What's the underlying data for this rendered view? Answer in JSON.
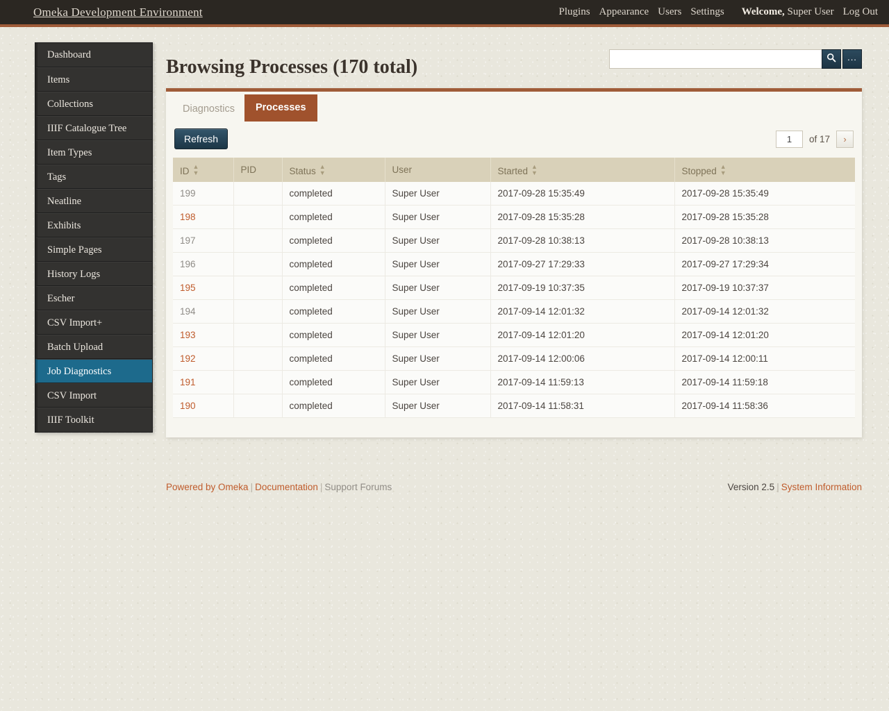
{
  "header": {
    "site_title": "Omeka Development Environment",
    "nav": [
      {
        "label": "Plugins"
      },
      {
        "label": "Appearance"
      },
      {
        "label": "Users"
      },
      {
        "label": "Settings"
      }
    ],
    "welcome_label": "Welcome,",
    "user_name": "Super User",
    "logout_label": "Log Out",
    "accent_color": "#a05c39",
    "bar_color": "#2b2722"
  },
  "sidebar": {
    "items": [
      {
        "label": "Dashboard",
        "active": false
      },
      {
        "label": "Items",
        "active": false
      },
      {
        "label": "Collections",
        "active": false
      },
      {
        "label": "IIIF Catalogue Tree",
        "active": false
      },
      {
        "label": "Item Types",
        "active": false
      },
      {
        "label": "Tags",
        "active": false
      },
      {
        "label": "Neatline",
        "active": false
      },
      {
        "label": "Exhibits",
        "active": false
      },
      {
        "label": "Simple Pages",
        "active": false
      },
      {
        "label": "History Logs",
        "active": false
      },
      {
        "label": "Escher",
        "active": false
      },
      {
        "label": "CSV Import+",
        "active": false
      },
      {
        "label": "Batch Upload",
        "active": false
      },
      {
        "label": "Job Diagnostics",
        "active": true
      },
      {
        "label": "CSV Import",
        "active": false
      },
      {
        "label": "IIIF Toolkit",
        "active": false
      }
    ],
    "active_color": "#1d6a8c"
  },
  "main": {
    "page_title": "Browsing Processes (170 total)",
    "search": {
      "value": "",
      "placeholder": "",
      "search_icon": "search-icon",
      "options_label": "..."
    },
    "tabs": [
      {
        "label": "Diagnostics",
        "active": false
      },
      {
        "label": "Processes",
        "active": true
      }
    ],
    "tab_active_color": "#a0522d",
    "toolbar": {
      "refresh_label": "Refresh"
    },
    "pagination": {
      "current_page": "1",
      "of_label": "of 17",
      "next_icon": "chevron-right-icon"
    },
    "table": {
      "columns": [
        {
          "label": "ID",
          "sortable": true
        },
        {
          "label": "PID",
          "sortable": false
        },
        {
          "label": "Status",
          "sortable": true
        },
        {
          "label": "User",
          "sortable": false
        },
        {
          "label": "Started",
          "sortable": true
        },
        {
          "label": "Stopped",
          "sortable": true
        }
      ],
      "rows": [
        {
          "id": "199",
          "id_style": "gray",
          "pid": "",
          "status": "completed",
          "user": "Super User",
          "started": "2017-09-28 15:35:49",
          "stopped": "2017-09-28 15:35:49"
        },
        {
          "id": "198",
          "id_style": "orange",
          "pid": "",
          "status": "completed",
          "user": "Super User",
          "started": "2017-09-28 15:35:28",
          "stopped": "2017-09-28 15:35:28"
        },
        {
          "id": "197",
          "id_style": "gray",
          "pid": "",
          "status": "completed",
          "user": "Super User",
          "started": "2017-09-28 10:38:13",
          "stopped": "2017-09-28 10:38:13"
        },
        {
          "id": "196",
          "id_style": "gray",
          "pid": "",
          "status": "completed",
          "user": "Super User",
          "started": "2017-09-27 17:29:33",
          "stopped": "2017-09-27 17:29:34"
        },
        {
          "id": "195",
          "id_style": "orange",
          "pid": "",
          "status": "completed",
          "user": "Super User",
          "started": "2017-09-19 10:37:35",
          "stopped": "2017-09-19 10:37:37"
        },
        {
          "id": "194",
          "id_style": "gray",
          "pid": "",
          "status": "completed",
          "user": "Super User",
          "started": "2017-09-14 12:01:32",
          "stopped": "2017-09-14 12:01:32"
        },
        {
          "id": "193",
          "id_style": "orange",
          "pid": "",
          "status": "completed",
          "user": "Super User",
          "started": "2017-09-14 12:01:20",
          "stopped": "2017-09-14 12:01:20"
        },
        {
          "id": "192",
          "id_style": "orange",
          "pid": "",
          "status": "completed",
          "user": "Super User",
          "started": "2017-09-14 12:00:06",
          "stopped": "2017-09-14 12:00:11"
        },
        {
          "id": "191",
          "id_style": "orange",
          "pid": "",
          "status": "completed",
          "user": "Super User",
          "started": "2017-09-14 11:59:13",
          "stopped": "2017-09-14 11:59:18"
        },
        {
          "id": "190",
          "id_style": "orange",
          "pid": "",
          "status": "completed",
          "user": "Super User",
          "started": "2017-09-14 11:58:31",
          "stopped": "2017-09-14 11:58:36"
        }
      ]
    }
  },
  "footer": {
    "powered_by": "Powered by Omeka",
    "documentation": "Documentation",
    "support_forums": "Support Forums",
    "version": "Version 2.5",
    "system_information": "System Information",
    "separator": "|",
    "link_color": "#bf5b2b"
  }
}
